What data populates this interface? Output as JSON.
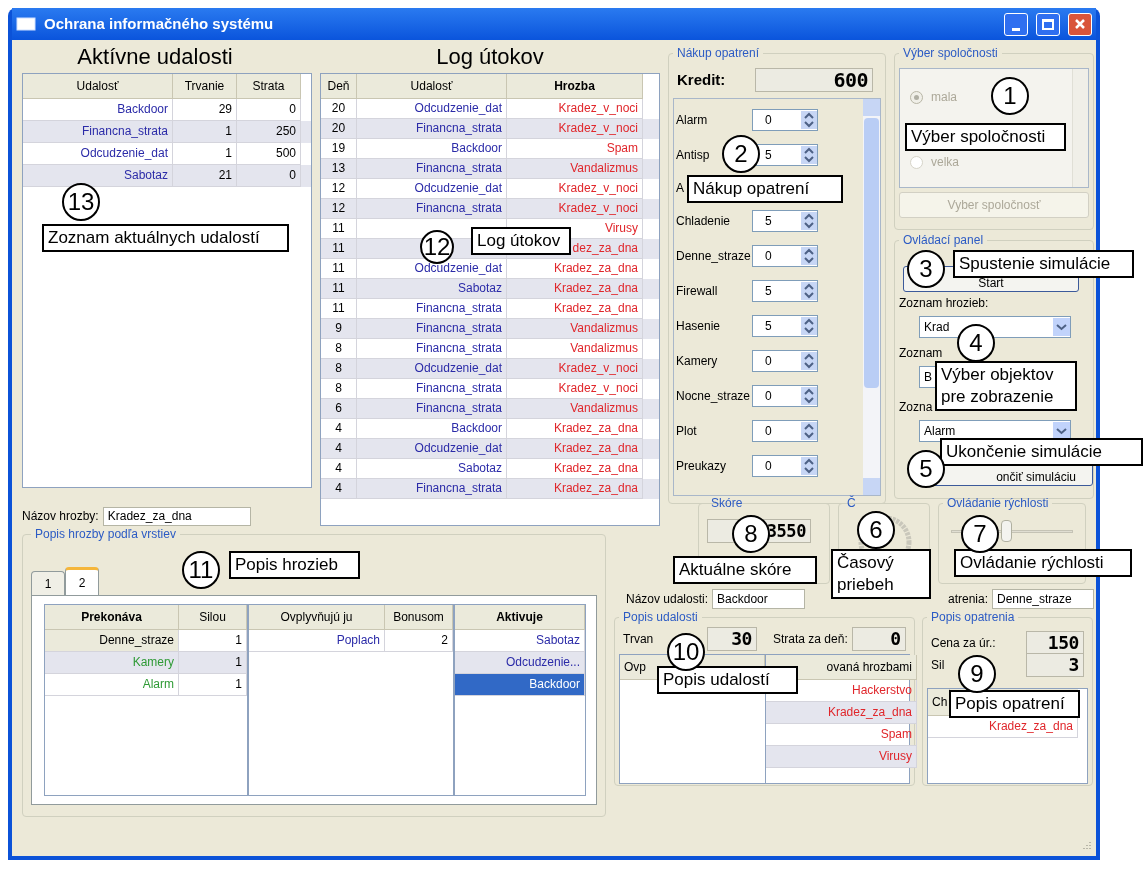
{
  "window": {
    "title": "Ochrana informačného systému"
  },
  "active_events": {
    "heading": "Aktívne udalosti",
    "columns": [
      "Udalosť",
      "Trvanie",
      "Strata"
    ],
    "rows": [
      {
        "event": "Backdoor",
        "duration": "29",
        "loss": "0"
      },
      {
        "event": "Financna_strata",
        "duration": "1",
        "loss": "250"
      },
      {
        "event": "Odcudzenie_dat",
        "duration": "1",
        "loss": "500"
      },
      {
        "event": "Sabotaz",
        "duration": "21",
        "loss": "0"
      }
    ]
  },
  "attack_log": {
    "heading": "Log útokov",
    "columns": [
      "Deň",
      "Udalosť",
      "Hrozba"
    ],
    "rows": [
      {
        "day": "20",
        "event": "Odcudzenie_dat",
        "threat": "Kradez_v_noci"
      },
      {
        "day": "20",
        "event": "Financna_strata",
        "threat": "Kradez_v_noci"
      },
      {
        "day": "19",
        "event": "Backdoor",
        "threat": "Spam"
      },
      {
        "day": "13",
        "event": "Financna_strata",
        "threat": "Vandalizmus"
      },
      {
        "day": "12",
        "event": "Odcudzenie_dat",
        "threat": "Kradez_v_noci"
      },
      {
        "day": "12",
        "event": "Financna_strata",
        "threat": "Kradez_v_noci"
      },
      {
        "day": "11",
        "threat": "Virusy"
      },
      {
        "day": "11",
        "threat": "dez_za_dna"
      },
      {
        "day": "11",
        "event": "Odcudzenie_dat",
        "threat": "Kradez_za_dna"
      },
      {
        "day": "11",
        "event": "Sabotaz",
        "threat": "Kradez_za_dna"
      },
      {
        "day": "11",
        "event": "Financna_strata",
        "threat": "Kradez_za_dna"
      },
      {
        "day": "9",
        "event": "Financna_strata",
        "threat": "Vandalizmus"
      },
      {
        "day": "8",
        "event": "Financna_strata",
        "threat": "Vandalizmus"
      },
      {
        "day": "8",
        "event": "Odcudzenie_dat",
        "threat": "Kradez_v_noci"
      },
      {
        "day": "8",
        "event": "Financna_strata",
        "threat": "Kradez_v_noci"
      },
      {
        "day": "6",
        "event": "Financna_strata",
        "threat": "Vandalizmus"
      },
      {
        "day": "4",
        "event": "Backdoor",
        "threat": "Kradez_za_dna"
      },
      {
        "day": "4",
        "event": "Odcudzenie_dat",
        "threat": "Kradez_za_dna"
      },
      {
        "day": "4",
        "event": "Sabotaz",
        "threat": "Kradez_za_dna"
      },
      {
        "day": "4",
        "event": "Financna_strata",
        "threat": "Kradez_za_dna"
      }
    ]
  },
  "purchase": {
    "legend": "Nákup opatrení",
    "credit_label": "Kredit:",
    "credit": "600",
    "items": [
      {
        "label": "Alarm",
        "value": "0"
      },
      {
        "label": "Antisp",
        "value": "5"
      },
      {
        "label": "A"
      },
      {
        "label": "Chladenie",
        "value": "5"
      },
      {
        "label": "Denne_straze",
        "value": "0"
      },
      {
        "label": "Firewall",
        "value": "5"
      },
      {
        "label": "Hasenie",
        "value": "5"
      },
      {
        "label": "Kamery",
        "value": "0"
      },
      {
        "label": "Nocne_straze",
        "value": "0"
      },
      {
        "label": "Plot",
        "value": "0"
      },
      {
        "label": "Preukazy",
        "value": "0"
      }
    ]
  },
  "company": {
    "legend": "Výber spoločnosti",
    "disabled": true,
    "options": [
      {
        "label": "mala",
        "selected": true
      },
      {
        "label": "velka",
        "selected": false
      }
    ],
    "button": "Vyber spoločnosť"
  },
  "control_panel": {
    "legend": "Ovládací panel",
    "start_button": "Start",
    "lists": [
      {
        "label": "Zoznam hrozieb:",
        "value": "Krad"
      },
      {
        "label": "Zoznam",
        "value": "B"
      },
      {
        "label": "Zozna",
        "value": "Alarm"
      }
    ],
    "stop_button": "ončiť simuláciu"
  },
  "score": {
    "legend": "Skóre",
    "value": "3550"
  },
  "time": {
    "legend": "Č"
  },
  "speed": {
    "legend": "Ovládanie rýchlosti",
    "level": 0.45
  },
  "event_name": {
    "label": "Názov udalosti:",
    "value": "Backdoor"
  },
  "measure_name": {
    "label": "atrenia:",
    "value": "Denne_straze"
  },
  "event_description": {
    "legend": "Popis udalosti",
    "duration_label": "Trvan",
    "duration": "30",
    "loss_label": "Strata za deň:",
    "loss": "0",
    "columns": [
      "Ovp",
      "ovaná hrozbami"
    ],
    "right_rows": [
      "Hackerstvo",
      "Kradez_za_dna",
      "Spam",
      "Virusy"
    ]
  },
  "measure_description": {
    "legend": "Popis opatrenia",
    "price_label": "Cena za úr.:",
    "price": "150",
    "strength_label": "Sil",
    "strength": "3",
    "column": "Ch",
    "rows": [
      "Kradez_za_dna"
    ]
  },
  "threat_name": {
    "label": "Názov hrozby:",
    "value": "Kradez_za_dna"
  },
  "threat_layers": {
    "legend": "Popis hrozby podľa vrstiev",
    "tabs": [
      {
        "label": "1",
        "selected": false
      },
      {
        "label": "2",
        "selected": true
      }
    ],
    "overcomes": {
      "columns": [
        "Prekonáva",
        "Silou"
      ],
      "rows": [
        {
          "name": "Denne_straze",
          "value": "1",
          "selected": true
        },
        {
          "name": "Kamery",
          "value": "1",
          "selected": false
        },
        {
          "name": "Alarm",
          "value": "1",
          "selected": false
        }
      ]
    },
    "influenced": {
      "columns": [
        "Ovplyvňujú ju",
        "Bonusom"
      ],
      "rows": [
        {
          "name": "Poplach",
          "value": "2"
        }
      ]
    },
    "activates": {
      "column": "Aktivuje",
      "rows": [
        {
          "name": "Sabotaz",
          "selected": false
        },
        {
          "name": "Odcudzenie...",
          "selected": false
        },
        {
          "name": "Backdoor",
          "selected": true
        }
      ]
    }
  },
  "callouts": [
    {
      "number": "1",
      "text": "Výber spoločnosti"
    },
    {
      "number": "2",
      "text": "Nákup opatrení"
    },
    {
      "number": "3",
      "text": "Spustenie simulácie"
    },
    {
      "number": "4",
      "text": "Výber objektov pre zobrazenie"
    },
    {
      "number": "5",
      "text": "Ukončenie simulácie"
    },
    {
      "number": "8",
      "text": "Aktuálne skóre"
    },
    {
      "number": "6",
      "text": "Časový priebeh"
    },
    {
      "number": "7",
      "text": "Ovládanie rýchlosti"
    },
    {
      "number": "10",
      "text": "Popis udalostí"
    },
    {
      "number": "9",
      "text": "Popis opatrení"
    },
    {
      "number": "11",
      "text": "Popis hrozieb"
    },
    {
      "number": "13",
      "text": "Zoznam aktuálnych udalostí"
    },
    {
      "number": "12",
      "text": "Log útokov"
    }
  ]
}
